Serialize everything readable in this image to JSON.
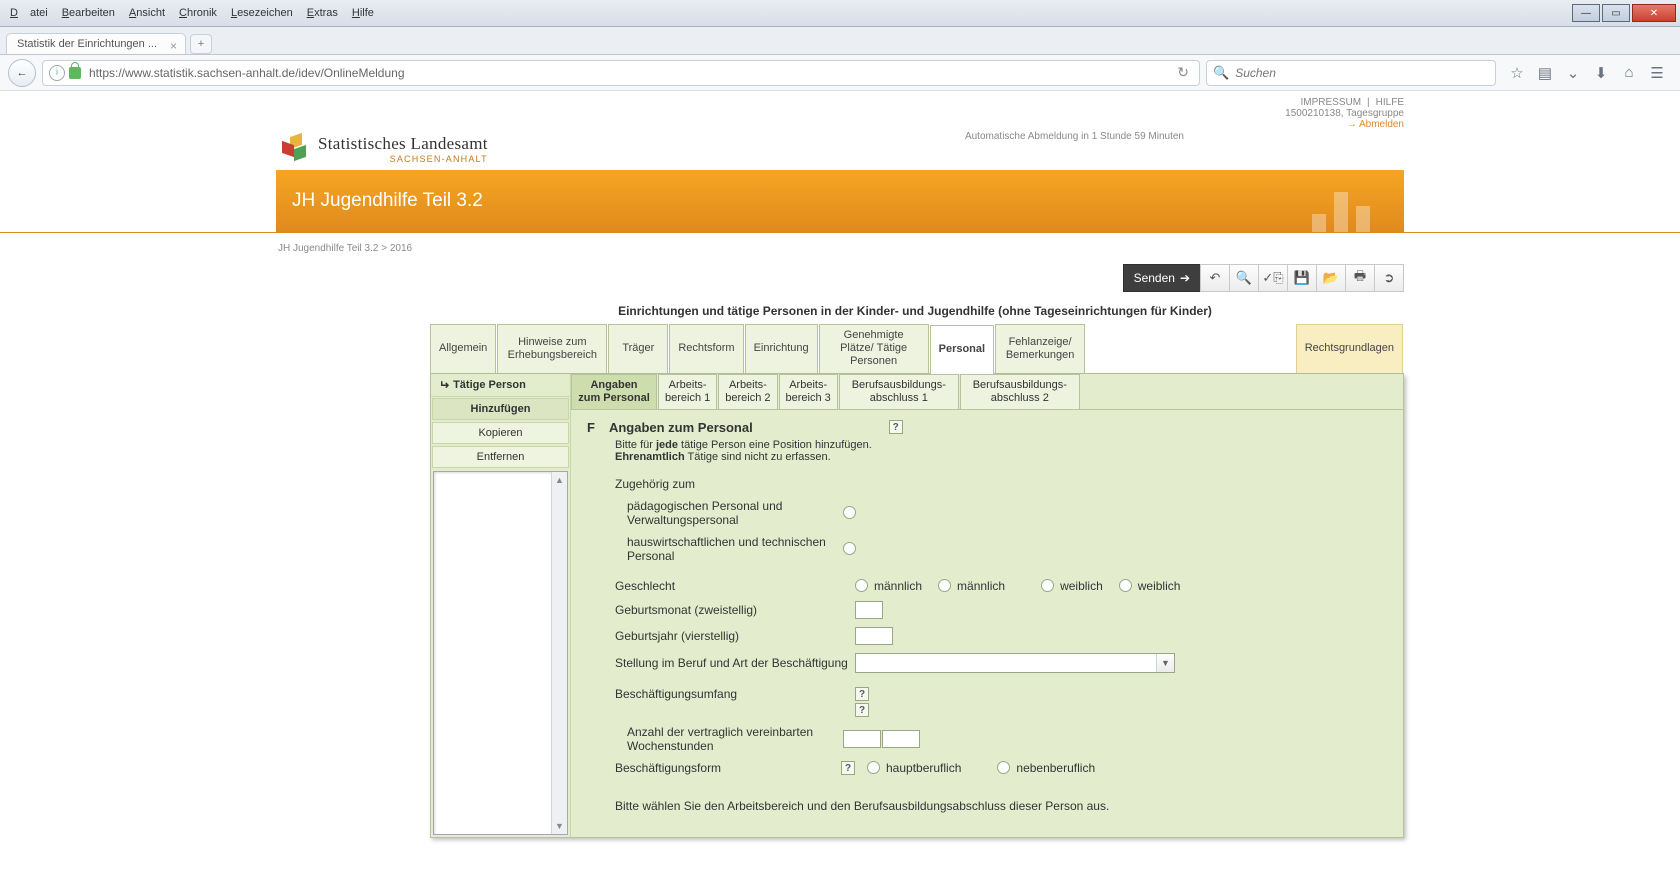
{
  "browser": {
    "menu": {
      "file": "Datei",
      "edit": "Bearbeiten",
      "view": "Ansicht",
      "history": "Chronik",
      "bookmarks": "Lesezeichen",
      "extras": "Extras",
      "help": "Hilfe"
    },
    "tab_title": "Statistik der Einrichtungen ...",
    "url": "https://www.statistik.sachsen-anhalt.de/idev/OnlineMeldung",
    "search_placeholder": "Suchen"
  },
  "header": {
    "impressum": "IMPRESSUM",
    "hilfe": "HILFE",
    "account": "1500210138, Tagesgruppe",
    "abmelden": "Abmelden",
    "auto_logout": "Automatische Abmeldung in 1 Stunde 59 Minuten",
    "logo1": "Statistisches Landesamt",
    "logo2": "SACHSEN-ANHALT",
    "banner_title": "JH Jugendhilfe Teil 3.2",
    "breadcrumb": "JH Jugendhilfe Teil 3.2 > 2016"
  },
  "toolbar": {
    "send": "Senden"
  },
  "section_title": "Einrichtungen und tätige Personen in der Kinder- und Jugendhilfe (ohne Tageseinrichtungen für Kinder)",
  "tabs_primary": [
    "Allgemein",
    "Hinweise zum Erhebungsbereich",
    "Träger",
    "Rechtsform",
    "Einrichtung",
    "Genehmigte Plätze/ Tätige Personen",
    "Personal",
    "Fehlanzeige/ Bemerkungen"
  ],
  "tab_legal": "Rechtsgrundlagen",
  "side": {
    "head": "Tätige Person",
    "add": "Hinzufügen",
    "copy": "Kopieren",
    "remove": "Entfernen"
  },
  "tabs_secondary": [
    "Angaben zum Personal",
    "Arbeits- bereich 1",
    "Arbeits- bereich 2",
    "Arbeits- bereich 3",
    "Berufsausbildungs- abschluss 1",
    "Berufsausbildungs- abschluss 2"
  ],
  "form": {
    "letter": "F",
    "heading": "Angaben zum Personal",
    "hint1": "Bitte für jede tätige Person eine Position hinzufügen.",
    "hint1_b": "jede",
    "hint2": "Ehrenamtlich Tätige sind nicht zu erfassen.",
    "hint2_b": "Ehrenamtlich",
    "zug": "Zugehörig zum",
    "zug1": "pädagogischen Personal und Verwaltungspersonal",
    "zug2": "hauswirtschaftlichen und technischen Personal",
    "gesch": "Geschlecht",
    "m": "männlich",
    "w": "weiblich",
    "gebm": "Geburtsmonat (zweistellig)",
    "gebj": "Geburtsjahr (vierstellig)",
    "stellung": "Stellung im Beruf und Art der Beschäftigung",
    "umfang": "Beschäftigungsumfang",
    "wochen": "Anzahl der vertraglich vereinbarten Wochenstunden",
    "form_lbl": "Beschäftigungsform",
    "haupt": "hauptberuflich",
    "neben": "nebenberuflich",
    "foot": "Bitte wählen Sie den Arbeitsbereich und den Berufsausbildungsabschluss dieser Person aus."
  }
}
